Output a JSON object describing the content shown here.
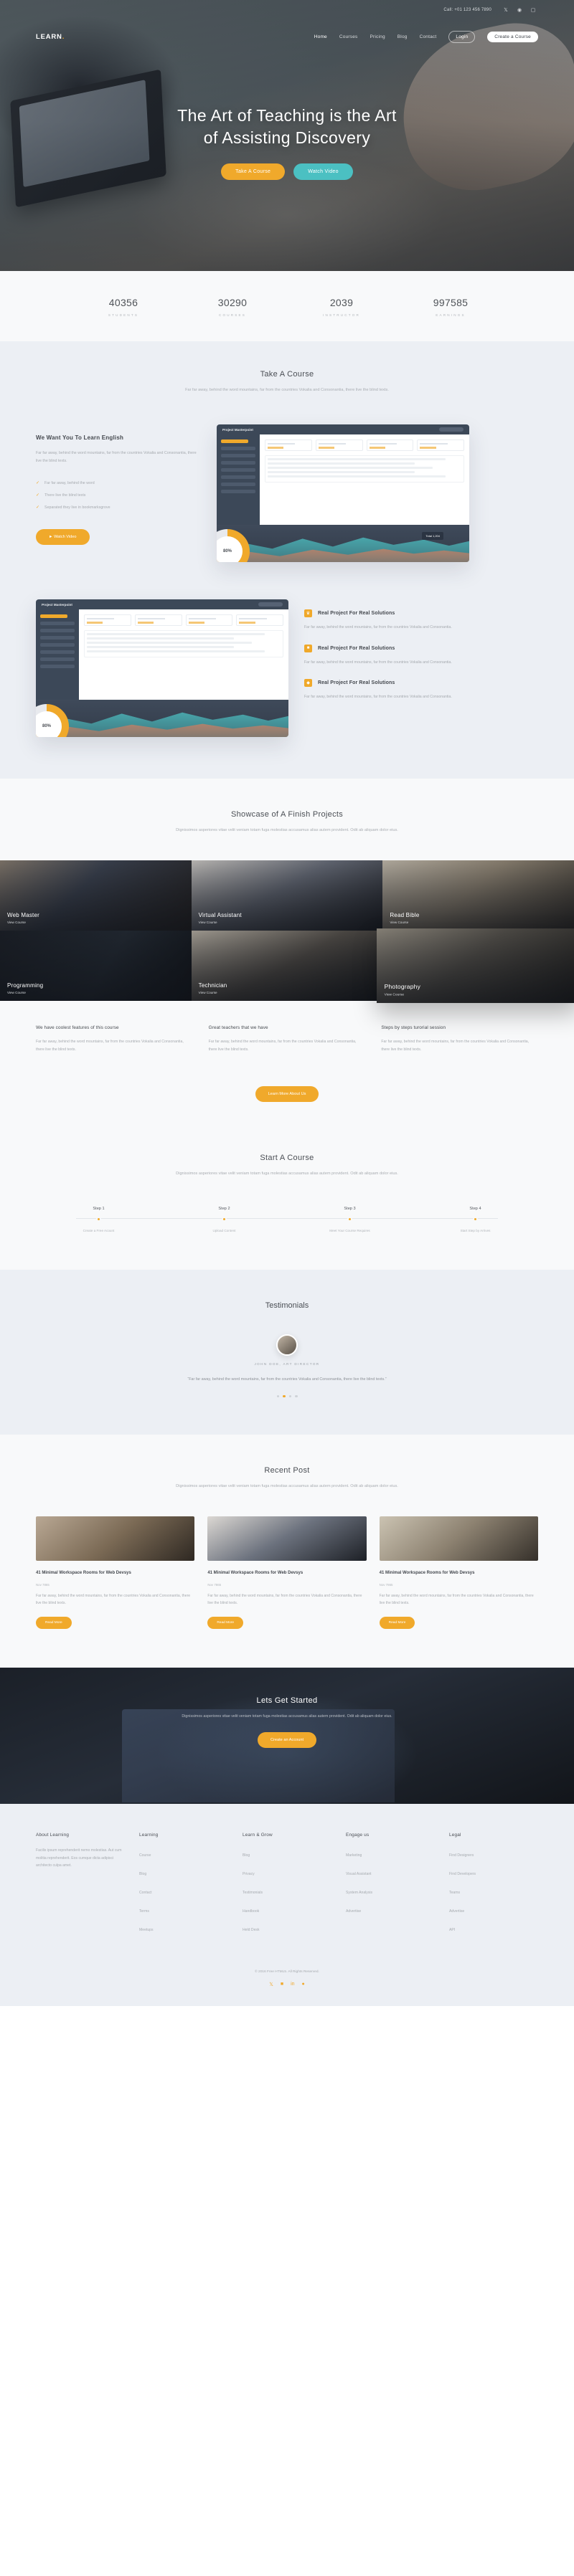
{
  "topbar": {
    "call": "Call: +01 123 456 7890",
    "social": [
      "twitter-icon",
      "facebook-icon",
      "instagram-icon"
    ]
  },
  "nav": {
    "logo": "LEARN",
    "logo_dot": ".",
    "links": [
      "Home",
      "Courses",
      "Pricing",
      "Blog",
      "Contact"
    ],
    "login": "Login",
    "create": "Create a Course"
  },
  "hero": {
    "title_line1": "The Art of Teaching is the Art",
    "title_line2": "of Assisting Discovery",
    "btn_primary": "Take A Course",
    "btn_secondary": "Watch Video"
  },
  "stats": [
    {
      "num": "40356",
      "label": "STUDENTS"
    },
    {
      "num": "30290",
      "label": "COURSES"
    },
    {
      "num": "2039",
      "label": "INSTRUCTOR"
    },
    {
      "num": "997585",
      "label": "EARNINGS"
    }
  ],
  "course_section": {
    "title": "Take A Course",
    "subtitle": "Far far away, behind the word mountains, far from the countries Vokalia and Consonantia, there live the blind texts.",
    "feature": {
      "heading": "We Want You To Learn English",
      "body": "Far far away, behind the word mountains, far from the countries Vokalia and Consonantia, there live the blind texts.",
      "ticks": [
        "Far far away, behind the word",
        "There live the blind texts",
        "Separated they live in bookmarksgrove"
      ],
      "button": "Watch Video"
    },
    "dashboard": {
      "title": "Project Masterpoint",
      "percent": "80%",
      "tooltip": "Total 1,204"
    },
    "points": [
      {
        "icon": "trophy-icon",
        "heading": "Real Project For Real Solutions",
        "body": "Far far away, behind the word mountains, far from the countries Vokalia and Consonantia."
      },
      {
        "icon": "briefcase-icon",
        "heading": "Real Project For Real Solutions",
        "body": "Far far away, behind the word mountains, far from the countries Vokalia and Consonantia."
      },
      {
        "icon": "medal-icon",
        "heading": "Real Project For Real Solutions",
        "body": "Far far away, behind the word mountains, far from the countries Vokalia and Consonantia."
      }
    ]
  },
  "showcase": {
    "title": "Showcase of A Finish Projects",
    "subtitle": "Dignissimos asperiores vitae velit veniam totam fuga molestias accusamus alias autem provident. Odit ab aliquam dolor eius.",
    "view_course": "View Course",
    "items": [
      {
        "title": "Web Master",
        "tone": "ph-a"
      },
      {
        "title": "Virtual Assistant",
        "tone": "ph-b"
      },
      {
        "title": "Read Bible",
        "tone": "ph-c"
      },
      {
        "title": "Programming",
        "tone": "ph-d"
      },
      {
        "title": "Technician",
        "tone": "ph-e"
      },
      {
        "title": "Photography",
        "tone": "ph-f"
      }
    ],
    "columns": [
      {
        "heading": "We have coolest features of this course",
        "body": "Far far away, behind the word mountains, far from the countries Vokalia and Consonantia, there live the blind texts."
      },
      {
        "heading": "Great teachers that we have",
        "body": "Far far away, behind the word mountains, far from the countries Vokalia and Consonantia, there live the blind texts."
      },
      {
        "heading": "Steps by steps turorial session",
        "body": "Far far away, behind the word mountains, far from the countries Vokalia and Consonantia, there live the blind texts."
      }
    ],
    "button": "Learn More About Us"
  },
  "start": {
    "title": "Start A Course",
    "subtitle": "Dignissimos asperiores vitae velit veniam totam fuga molestias accusamus alias autem provident. Odit ab aliquam dolor eius.",
    "steps": [
      {
        "label": "Step 1",
        "text": "Create a Free Acount"
      },
      {
        "label": "Step 2",
        "text": "Upload Content"
      },
      {
        "label": "Step 3",
        "text": "Meet Your Course Requires"
      },
      {
        "label": "Step 4",
        "text": "Start Step by Arrives"
      }
    ]
  },
  "testimonials": {
    "title": "Testimonials",
    "name": "JOHN DOE, ART DIRECTOR",
    "quote": "“Far far away, behind the word mountains, far from the countries Vokalia and Consonantia, there live the blind texts.”",
    "dots": 4,
    "active_dot": 1
  },
  "posts": {
    "title": "Recent Post",
    "subtitle": "Dignissimos asperiores vitae velit veniam totam fuga molestias accusamus alias autem provident. Odit ab aliquam dolor eius.",
    "items": [
      {
        "title": "41 Minimal Workspace Rooms for Web Devsys",
        "meta": "Nov 7865",
        "body": "Far far away, behind the word mountains, far from the countries Vokalia and Consonantia, there live the blind texts.",
        "button": "Read More",
        "tone": "pt-a"
      },
      {
        "title": "41 Minimal Workspace Rooms for Web Devsys",
        "meta": "Nov 7865",
        "body": "Far far away, behind the word mountains, far from the countries Vokalia and Consonantia, there live the blind texts.",
        "button": "Read More",
        "tone": "pt-b"
      },
      {
        "title": "41 Minimal Workspace Rooms for Web Devsys",
        "meta": "Nov 7865",
        "body": "Far far away, behind the word mountains, far from the countries Vokalia and Consonantia, there live the blind texts.",
        "button": "Read More",
        "tone": "pt-c"
      }
    ]
  },
  "cta": {
    "title": "Lets Get Started",
    "subtitle": "Dignissimos asperiores vitae velit veniam totam fuga molestias accusamus alias autem provident. Odit ab aliquam dolor eius.",
    "button": "Create an Account"
  },
  "footer": {
    "about": {
      "heading": "About Learning",
      "body": "Facilis ipsum reprehenderit nemo molestias. Aut cum molitia reprehenderit. Eos cumque dicta adipisci architecto culpa amet."
    },
    "columns": [
      {
        "heading": "Learning",
        "links": [
          "Course",
          "Blog",
          "Contact",
          "Terms",
          "Meetups"
        ]
      },
      {
        "heading": "Learn & Grow",
        "links": [
          "Blog",
          "Privacy",
          "Testimonials",
          "Handbook",
          "Held Desk"
        ]
      },
      {
        "heading": "Engage us",
        "links": [
          "Marketing",
          "Visual Assistant",
          "System Analysis",
          "Advertise"
        ]
      },
      {
        "heading": "Legal",
        "links": [
          "Find Designers",
          "Find Developers",
          "Teams",
          "Advertise",
          "API"
        ]
      }
    ],
    "copyright": "© 2016 Free HTML5. All Rights Reserved.",
    "social": [
      "twitter-icon",
      "facebook-icon",
      "linkedin-icon",
      "dribbble-icon"
    ]
  },
  "colors": {
    "accent": "#f0a92b",
    "teal": "#4bc0c2",
    "dark": "#3c4858",
    "muted": "#a7abb0"
  }
}
